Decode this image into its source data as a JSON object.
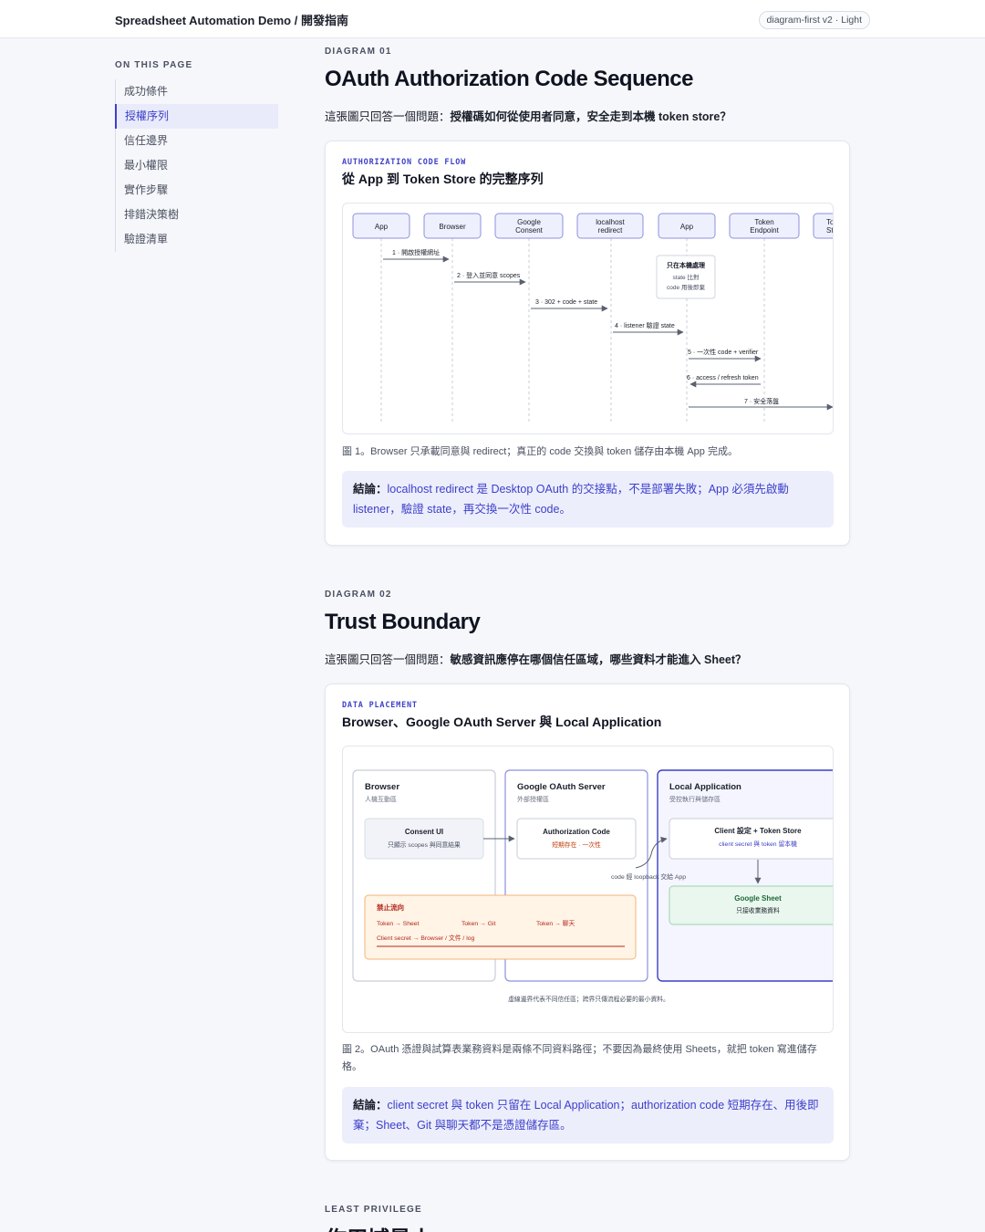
{
  "header": {
    "title": "Spreadsheet Automation Demo / 開發指南",
    "badge": "diagram-first v2 · Light"
  },
  "toc": {
    "title": "ON THIS PAGE",
    "items": [
      "成功條件",
      "授權序列",
      "信任邊界",
      "最小權限",
      "實作步驟",
      "排錯決策樹",
      "驗證清單"
    ],
    "active_index": 1
  },
  "diagram1": {
    "eyebrow": "DIAGRAM 01",
    "title": "OAuth Authorization Code Sequence",
    "lead_prefix": "這張圖只回答一個問題：",
    "lead_bold": "授權碼如何從使用者同意，安全走到本機 token store？",
    "kicker": "AUTHORIZATION CODE FLOW",
    "card_title": "從 App 到 Token Store 的完整序列",
    "actors": [
      "App",
      "Browser",
      "Google\nConsent",
      "localhost\nredirect",
      "App",
      "Token\nEndpoint",
      "To\nSt"
    ],
    "messages": [
      "1 · 開啟授權網址",
      "2 · 登入並同意 scopes",
      "3 · 302 + code + state",
      "4 · listener 驗證 state",
      "5 · 一次性 code + verifier",
      "6 · access / refresh token",
      "7 · 安全落盤"
    ],
    "note": {
      "title": "只在本機處理",
      "line1": "state 比對",
      "line2": "code 用後即棄"
    },
    "caption": "圖 1。Browser 只承載同意與 redirect；真正的 code 交換與 token 儲存由本機 App 完成。",
    "conclusion_label": "結論：",
    "conclusion_text": "localhost redirect 是 Desktop OAuth 的交接點，不是部署失敗；App 必須先啟動 listener，驗證 state，再交換一次性 code。"
  },
  "diagram2": {
    "eyebrow": "DIAGRAM 02",
    "title": "Trust Boundary",
    "lead_prefix": "這張圖只回答一個問題：",
    "lead_bold": "敏感資訊應停在哪個信任區域，哪些資料才能進入 Sheet？",
    "kicker": "DATA PLACEMENT",
    "card_title": "Browser、Google OAuth Server 與 Local Application",
    "zones": [
      {
        "title": "Browser",
        "subtitle": "人機互動區"
      },
      {
        "title": "Google OAuth Server",
        "subtitle": "外部授權區"
      },
      {
        "title": "Local Application",
        "subtitle": "受控執行與儲存區"
      }
    ],
    "boxes": {
      "consent_title": "Consent UI",
      "consent_sub": "只顯示 scopes 與同意結果",
      "authcode_title": "Authorization Code",
      "authcode_sub": "短期存在 · 一次性",
      "client_title": "Client 設定 + Token Store",
      "client_sub": "client secret 與 token 留本機",
      "sheet_title": "Google Sheet",
      "sheet_sub": "只接收業務資料"
    },
    "loopback_label": "code 經 loopback 交給 App",
    "forbidden": {
      "title": "禁止流向",
      "items": [
        "Token → Sheet",
        "Token → Git",
        "Token → 聊天"
      ],
      "item4": "Client secret → Browser / 文件 / log"
    },
    "footnote": "虛線邊界代表不同信任區；跨界只傳流程必要的最小資料。",
    "caption": "圖 2。OAuth 憑證與試算表業務資料是兩條不同資料路徑；不要因為最終使用 Sheets，就把 token 寫進儲存格。",
    "conclusion_label": "結論：",
    "conclusion_text": "client secret 與 token 只留在 Local Application；authorization code 短期存在、用後即棄；Sheet、Git 與聊天都不是憑證儲存區。"
  },
  "section3": {
    "eyebrow": "LEAST PRIVILEGE",
    "title": "作用域最小"
  },
  "colors": {
    "accent": "#3d3fc9",
    "accent_soft": "#eceefc",
    "actor_fill": "#eef0fd",
    "danger": "#b3261e",
    "warn_fill": "#fff4e5",
    "sheet_fill": "#e9f7ee"
  }
}
